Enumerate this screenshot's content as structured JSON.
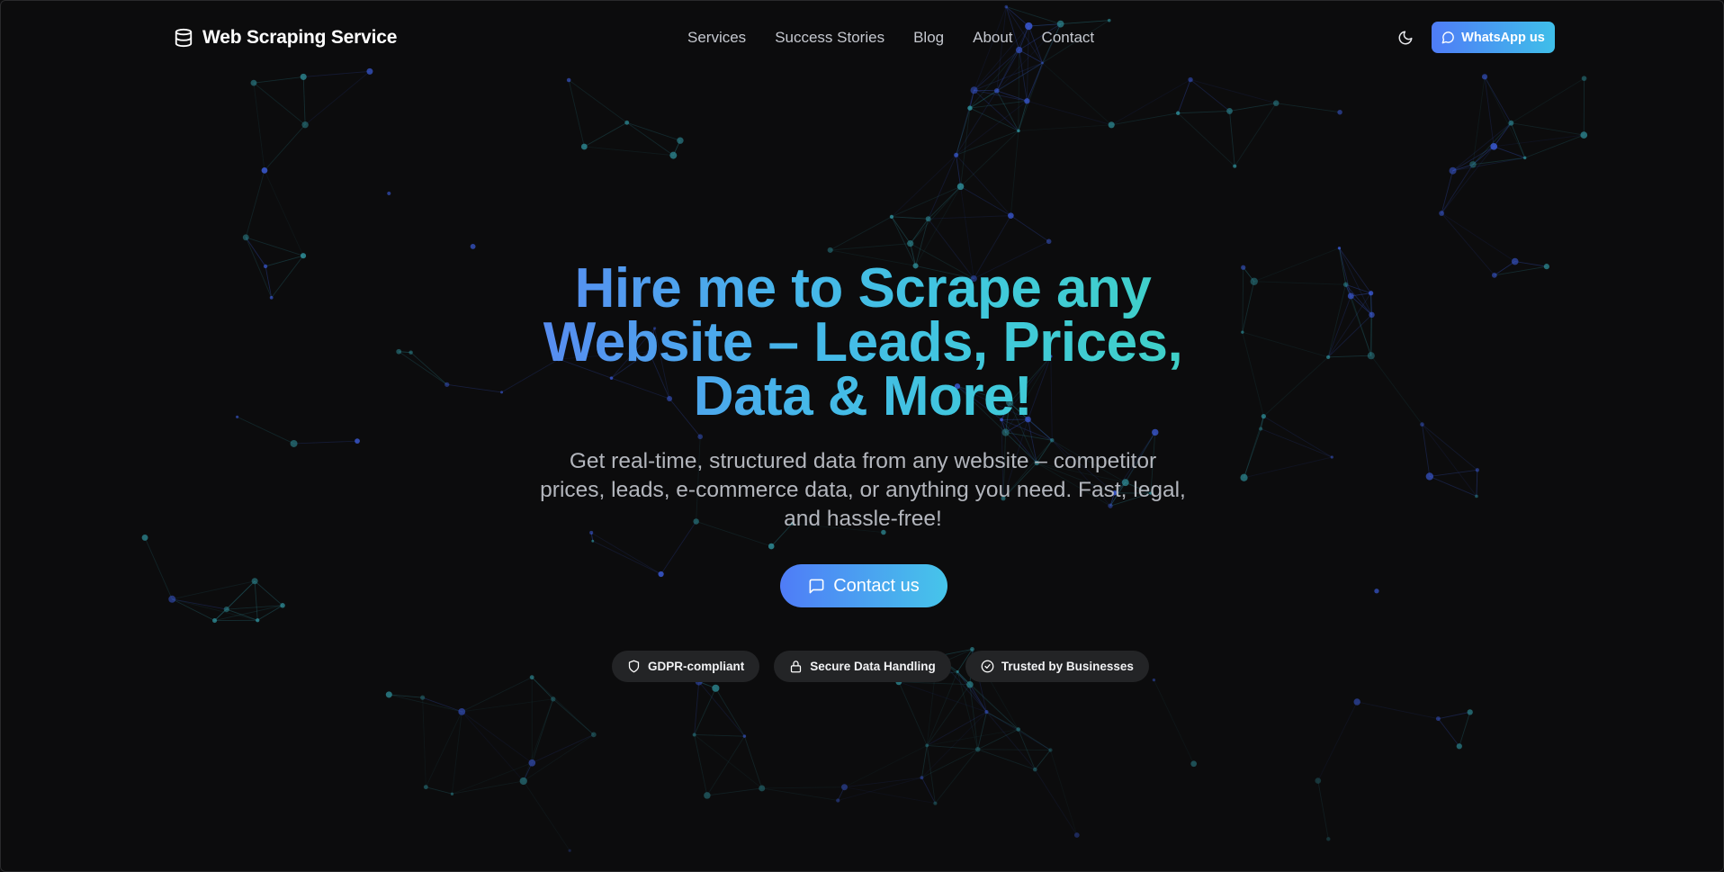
{
  "brand": {
    "title": "Web Scraping Service",
    "icon": "database-icon"
  },
  "nav": {
    "items": [
      {
        "label": "Services"
      },
      {
        "label": "Success Stories"
      },
      {
        "label": "Blog"
      },
      {
        "label": "About"
      },
      {
        "label": "Contact"
      }
    ]
  },
  "header_actions": {
    "theme_toggle_icon": "moon-icon",
    "whatsapp_label": "WhatsApp us",
    "whatsapp_icon": "message-circle-icon"
  },
  "hero": {
    "title_lines": [
      "Hire me to Scrape any",
      "Website – Leads, Prices,",
      "Data & More!"
    ],
    "subtitle_lines": [
      "Get real-time, structured data from any website – competitor",
      "prices, leads, e-commerce data, or anything you need. Fast, legal,",
      "and hassle-free!"
    ],
    "cta_label": "Contact us",
    "cta_icon": "message-square-icon"
  },
  "badges": [
    {
      "label": "GDPR-compliant",
      "icon": "shield-icon"
    },
    {
      "label": "Secure Data Handling",
      "icon": "lock-icon"
    },
    {
      "label": "Trusted by Businesses",
      "icon": "check-circle-icon"
    }
  ],
  "colors": {
    "background": "#0c0c0d",
    "accent_start": "#4f7cf7",
    "accent_end": "#3fd2c3",
    "network_blue": "#3b5bd9",
    "network_teal": "#2f8f9a"
  }
}
